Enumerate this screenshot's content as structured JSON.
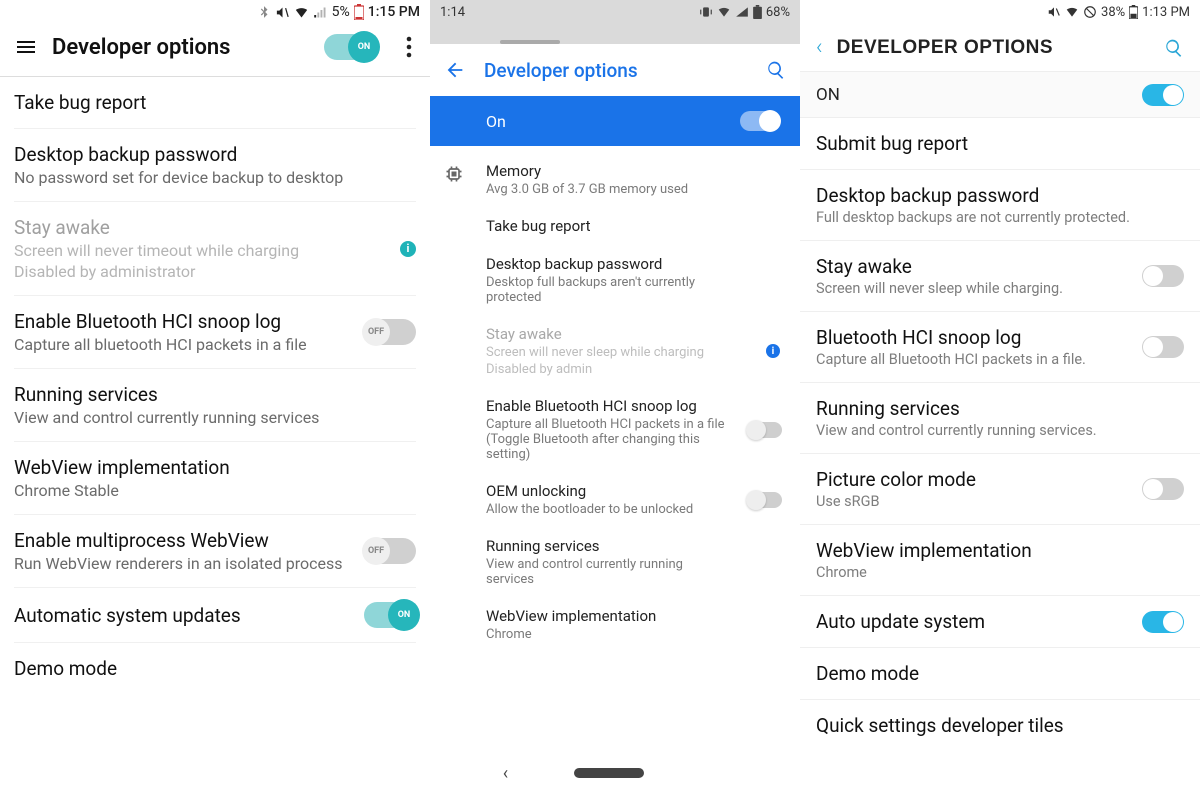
{
  "p1": {
    "status": {
      "battery": "5%",
      "time": "1:15 PM"
    },
    "header_title": "Developer options",
    "main_toggle_on_label": "ON",
    "items": {
      "bug": {
        "title": "Take bug report"
      },
      "backup": {
        "title": "Desktop backup password",
        "sub": "No password set for device backup to desktop"
      },
      "stay": {
        "title": "Stay awake",
        "sub1": "Screen will never timeout while charging",
        "sub2": "Disabled by administrator"
      },
      "bt": {
        "title": "Enable Bluetooth HCI snoop log",
        "sub": "Capture all bluetooth HCI packets in a file",
        "off": "OFF"
      },
      "run": {
        "title": "Running services",
        "sub": "View and control currently running services"
      },
      "webview": {
        "title": "WebView implementation",
        "sub": "Chrome Stable"
      },
      "multi": {
        "title": "Enable multiprocess WebView",
        "sub": "Run WebView renderers in an isolated process",
        "off": "OFF"
      },
      "auto": {
        "title": "Automatic system updates",
        "on": "ON"
      },
      "demo": {
        "title": "Demo mode"
      }
    }
  },
  "p2": {
    "status": {
      "time": "1:14",
      "battery": "68%"
    },
    "header_title": "Developer options",
    "on_label": "On",
    "items": {
      "mem": {
        "title": "Memory",
        "sub": "Avg 3.0 GB of 3.7 GB memory used"
      },
      "bug": {
        "title": "Take bug report"
      },
      "backup": {
        "title": "Desktop backup password",
        "sub": "Desktop full backups aren't currently protected"
      },
      "stay": {
        "title": "Stay awake",
        "sub1": "Screen will never sleep while charging",
        "sub2": "Disabled by admin"
      },
      "bt": {
        "title": "Enable Bluetooth HCI snoop log",
        "sub": "Capture all Bluetooth HCI packets in a file (Toggle Bluetooth after changing this setting)"
      },
      "oem": {
        "title": "OEM unlocking",
        "sub": "Allow the bootloader to be unlocked"
      },
      "run": {
        "title": "Running services",
        "sub": "View and control currently running services"
      },
      "webview": {
        "title": "WebView implementation",
        "sub": "Chrome"
      }
    }
  },
  "p3": {
    "status": {
      "battery": "38%",
      "time": "1:13 PM"
    },
    "header_title": "Developer Options",
    "on_label": "ON",
    "items": {
      "bug": {
        "title": "Submit bug report"
      },
      "backup": {
        "title": "Desktop backup password",
        "sub": "Full desktop backups are not currently protected."
      },
      "stay": {
        "title": "Stay awake",
        "sub": "Screen will never sleep while charging."
      },
      "bt": {
        "title": "Bluetooth HCI snoop log",
        "sub": "Capture all Bluetooth HCI packets in a file."
      },
      "run": {
        "title": "Running services",
        "sub": "View and control currently running services."
      },
      "pic": {
        "title": "Picture color mode",
        "sub": "Use sRGB"
      },
      "webview": {
        "title": "WebView implementation",
        "sub": "Chrome"
      },
      "auto": {
        "title": "Auto update system"
      },
      "demo": {
        "title": "Demo mode"
      },
      "quick": {
        "title": "Quick settings developer tiles"
      }
    }
  }
}
